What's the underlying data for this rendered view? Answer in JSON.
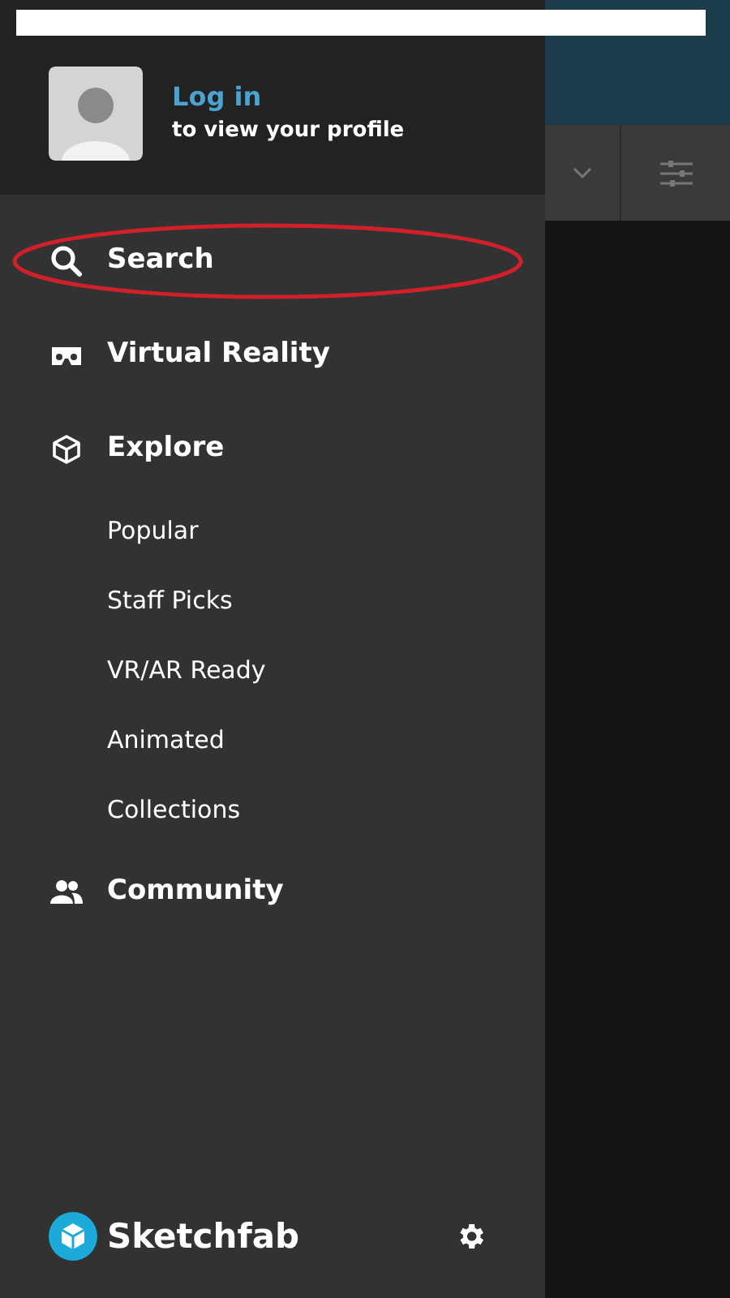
{
  "profile": {
    "link": "Log in",
    "subtitle": "to view your profile"
  },
  "menu": [
    {
      "label": "Search",
      "highlighted": true
    },
    {
      "label": "Virtual Reality",
      "highlighted": false
    },
    {
      "label": "Explore",
      "highlighted": false,
      "children": [
        {
          "label": "Popular"
        },
        {
          "label": "Staff Picks"
        },
        {
          "label": "VR/AR Ready"
        },
        {
          "label": "Animated"
        },
        {
          "label": "Collections"
        }
      ]
    },
    {
      "label": "Community",
      "highlighted": false
    }
  ],
  "footer": {
    "brand": "Sketchfab"
  }
}
